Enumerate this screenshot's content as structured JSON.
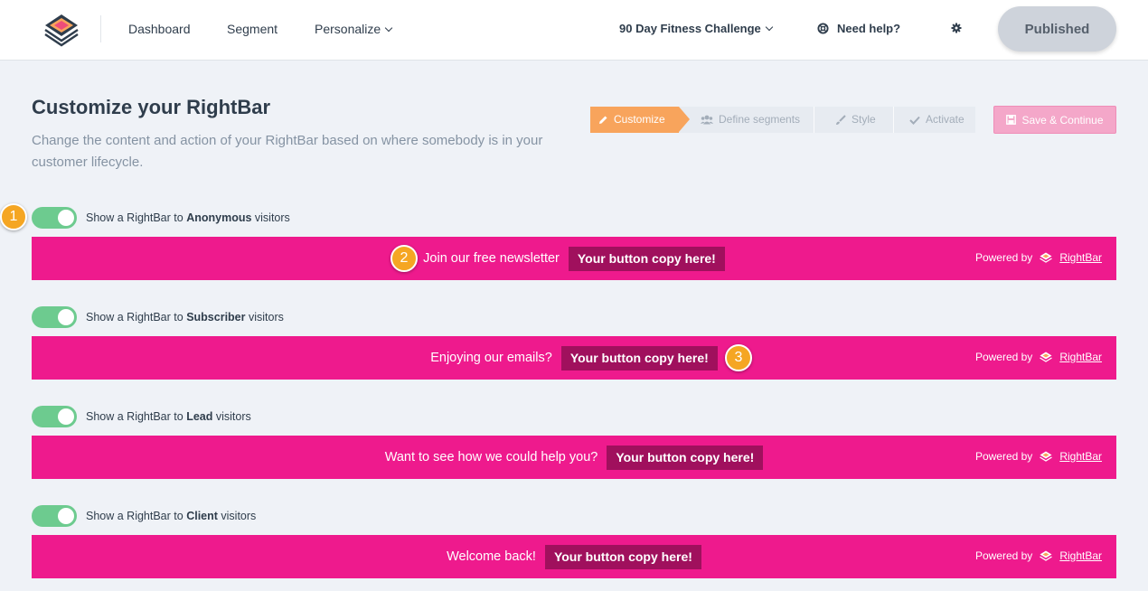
{
  "nav": {
    "dashboard": "Dashboard",
    "segment": "Segment",
    "personalize": "Personalize",
    "campaign": "90 Day Fitness Challenge",
    "help": "Need help?",
    "published": "Published"
  },
  "page": {
    "title": "Customize your RightBar",
    "description": "Change the content and action of your RightBar based on where somebody is in your customer lifecycle."
  },
  "stepper": {
    "steps": [
      "Customize",
      "Define segments",
      "Style",
      "Activate"
    ],
    "active": "Customize",
    "save": "Save & Continue"
  },
  "rows": [
    {
      "prefix": "Show a RightBar to",
      "audience": "Anonymous",
      "suffix": "visitors",
      "enabled": true,
      "message": "Join our free newsletter",
      "button": "Your button copy here!"
    },
    {
      "prefix": "Show a RightBar to",
      "audience": "Subscriber",
      "suffix": "visitors",
      "enabled": true,
      "message": "Enjoying our emails?",
      "button": "Your button copy here!"
    },
    {
      "prefix": "Show a RightBar to",
      "audience": "Lead",
      "suffix": "visitors",
      "enabled": true,
      "message": "Want to see how we could help you?",
      "button": "Your button copy here!"
    },
    {
      "prefix": "Show a RightBar to",
      "audience": "Client",
      "suffix": "visitors",
      "enabled": true,
      "message": "Welcome back!",
      "button": "Your button copy here!"
    }
  ],
  "powered": {
    "text": "Powered by",
    "link": "RightBar"
  },
  "markers": [
    "1",
    "2",
    "3"
  ],
  "colors": {
    "bar": "#ee1a8d",
    "bar_button": "#a0105d",
    "toggle_on": "#6dcb8f",
    "step_active": "#f8a45c",
    "marker": "#f5a623"
  },
  "icons": [
    "logo-icon",
    "chevron-down-icon",
    "lifebuoy-icon",
    "gear-icon",
    "pencil-icon",
    "users-icon",
    "brush-icon",
    "check-icon",
    "save-icon"
  ]
}
